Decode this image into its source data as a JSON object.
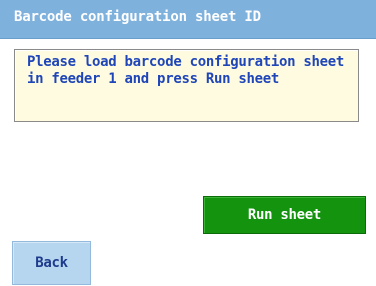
{
  "header": {
    "title": "Barcode configuration sheet ID"
  },
  "message": {
    "text": "Please load barcode configuration sheet in feeder 1 and press Run sheet"
  },
  "actions": {
    "run_sheet_label": "Run sheet",
    "back_label": "Back"
  },
  "colors": {
    "title_bar": "#7fb1dd",
    "message_background": "#fffbe0",
    "message_text": "#1f46b8",
    "run_button": "#14930f",
    "back_button": "#b6d5ee"
  }
}
